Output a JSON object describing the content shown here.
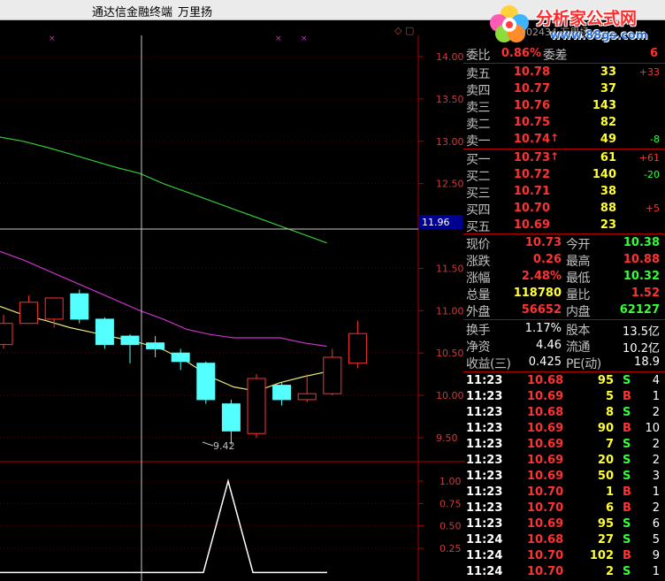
{
  "window": {
    "title": "通达信金融终端",
    "user": "万里扬"
  },
  "watermark": {
    "brand": "分析家公式网",
    "url": "www.88gs.com",
    "ghost_code": "002434 万里扬"
  },
  "colors": {
    "up": "#ff3232",
    "down": "#54ffff",
    "label": "#c0c0c0",
    "ma_green": "#34c834",
    "ma_magenta": "#c832c8",
    "ma_yellow": "#e6e678",
    "separator": "#b00000"
  },
  "chart": {
    "toolbar_icons": "◇ ▢",
    "price_ticks": [
      "14.00",
      "13.50",
      "13.00",
      "12.50",
      "11.50",
      "11.00",
      "10.50",
      "10.00",
      "9.50"
    ],
    "highlight_price": "11.96",
    "low_annotation": "9.42",
    "indicator_ticks": [
      "1.00",
      "0.75",
      "0.50",
      "0.25"
    ]
  },
  "chart_data": {
    "type": "candlestick",
    "ylim": [
      9.1,
      14.2
    ],
    "indicator_ylim": [
      0,
      1.15
    ],
    "candles": [
      {
        "open": 10.6,
        "close": 10.85,
        "high": 10.95,
        "low": 10.55
      },
      {
        "open": 10.85,
        "close": 11.1,
        "high": 11.18,
        "low": 10.85
      },
      {
        "open": 10.9,
        "close": 11.15,
        "high": 11.15,
        "low": 10.8
      },
      {
        "open": 11.2,
        "close": 10.9,
        "high": 11.25,
        "low": 10.85
      },
      {
        "open": 10.9,
        "close": 10.6,
        "high": 10.92,
        "low": 10.55
      },
      {
        "open": 10.7,
        "close": 10.6,
        "high": 10.72,
        "low": 10.38
      },
      {
        "open": 10.62,
        "close": 10.55,
        "high": 10.7,
        "low": 10.45
      },
      {
        "open": 10.5,
        "close": 10.4,
        "high": 10.55,
        "low": 10.3
      },
      {
        "open": 10.38,
        "close": 9.95,
        "high": 10.4,
        "low": 9.9
      },
      {
        "open": 9.9,
        "close": 9.58,
        "high": 9.95,
        "low": 9.42
      },
      {
        "open": 9.55,
        "close": 10.2,
        "high": 10.25,
        "low": 9.5
      },
      {
        "open": 10.12,
        "close": 9.95,
        "high": 10.15,
        "low": 9.88
      },
      {
        "open": 9.95,
        "close": 10.02,
        "high": 10.25,
        "low": 9.92
      },
      {
        "open": 10.02,
        "close": 10.45,
        "high": 10.55,
        "low": 10.0
      },
      {
        "open": 10.38,
        "close": 10.73,
        "high": 10.88,
        "low": 10.32
      }
    ],
    "ma_green": [
      13.05,
      13.0,
      12.93,
      12.85,
      12.77,
      12.69,
      12.62,
      12.5,
      12.4,
      12.3,
      12.2,
      12.1,
      12.0,
      11.9,
      11.8
    ],
    "ma_magenta": [
      11.7,
      11.6,
      11.48,
      11.36,
      11.24,
      11.12,
      11.0,
      10.9,
      10.78,
      10.72,
      10.68,
      10.68,
      10.68,
      10.62,
      10.58
    ],
    "ma_yellow": [
      11.05,
      10.95,
      10.88,
      10.8,
      10.74,
      10.68,
      10.62,
      10.54,
      10.4,
      10.22,
      10.1,
      10.05,
      10.15,
      10.22,
      10.28
    ],
    "signal": [
      0,
      0,
      0,
      0,
      0,
      0,
      0,
      0,
      0,
      0,
      0,
      0,
      1,
      0,
      0,
      0,
      0,
      0,
      0,
      0
    ]
  },
  "quote": {
    "weibi": {
      "label": "委比",
      "value": "0.86%",
      "label2": "委差",
      "value2": "6"
    },
    "asks": [
      {
        "label": "卖五",
        "price": "10.78",
        "vol": "33",
        "chg": "+33",
        "arrow": ""
      },
      {
        "label": "卖四",
        "price": "10.77",
        "vol": "37",
        "chg": "",
        "arrow": ""
      },
      {
        "label": "卖三",
        "price": "10.76",
        "vol": "143",
        "chg": "",
        "arrow": ""
      },
      {
        "label": "卖二",
        "price": "10.75",
        "vol": "82",
        "chg": "",
        "arrow": ""
      },
      {
        "label": "卖一",
        "price": "10.74",
        "vol": "49",
        "chg": "-8",
        "arrow": "↑"
      }
    ],
    "bids": [
      {
        "label": "买一",
        "price": "10.73",
        "vol": "61",
        "chg": "+61",
        "arrow": "↑"
      },
      {
        "label": "买二",
        "price": "10.72",
        "vol": "140",
        "chg": "-20",
        "arrow": ""
      },
      {
        "label": "买三",
        "price": "10.71",
        "vol": "38",
        "chg": "",
        "arrow": ""
      },
      {
        "label": "买四",
        "price": "10.70",
        "vol": "88",
        "chg": "+5",
        "arrow": ""
      },
      {
        "label": "买五",
        "price": "10.69",
        "vol": "23",
        "chg": "",
        "arrow": ""
      }
    ],
    "stats": [
      {
        "l1": "现价",
        "v1": "10.73",
        "c1": "red",
        "l2": "今开",
        "v2": "10.38",
        "c2": "green"
      },
      {
        "l1": "涨跌",
        "v1": "0.26",
        "c1": "red",
        "l2": "最高",
        "v2": "10.88",
        "c2": "red"
      },
      {
        "l1": "涨幅",
        "v1": "2.48%",
        "c1": "red",
        "l2": "最低",
        "v2": "10.32",
        "c2": "green"
      },
      {
        "l1": "总量",
        "v1": "118780",
        "c1": "yellow",
        "l2": "量比",
        "v2": "1.52",
        "c2": "red"
      },
      {
        "l1": "外盘",
        "v1": "56652",
        "c1": "red",
        "l2": "内盘",
        "v2": "62127",
        "c2": "green"
      }
    ],
    "stats2": [
      {
        "l1": "换手",
        "v1": "1.17%",
        "c1": "white",
        "l2": "股本",
        "v2": "13.5亿",
        "c2": "white"
      },
      {
        "l1": "净资",
        "v1": "4.46",
        "c1": "white",
        "l2": "流通",
        "v2": "10.2亿",
        "c2": "white"
      },
      {
        "l1": "收益(三)",
        "v1": "0.425",
        "c1": "white",
        "l2": "PE(动)",
        "v2": "18.9",
        "c2": "white"
      }
    ],
    "ticks": [
      {
        "time": "11:23",
        "price": "10.68",
        "vol": "95",
        "side": "S",
        "n": "4"
      },
      {
        "time": "11:23",
        "price": "10.69",
        "vol": "5",
        "side": "B",
        "n": "1"
      },
      {
        "time": "11:23",
        "price": "10.68",
        "vol": "8",
        "side": "S",
        "n": "2"
      },
      {
        "time": "11:23",
        "price": "10.69",
        "vol": "90",
        "side": "B",
        "n": "10"
      },
      {
        "time": "11:23",
        "price": "10.69",
        "vol": "7",
        "side": "S",
        "n": "2"
      },
      {
        "time": "11:23",
        "price": "10.69",
        "vol": "20",
        "side": "S",
        "n": "2"
      },
      {
        "time": "11:23",
        "price": "10.69",
        "vol": "50",
        "side": "S",
        "n": "3"
      },
      {
        "time": "11:23",
        "price": "10.70",
        "vol": "1",
        "side": "B",
        "n": "1"
      },
      {
        "time": "11:23",
        "price": "10.70",
        "vol": "6",
        "side": "B",
        "n": "2"
      },
      {
        "time": "11:23",
        "price": "10.69",
        "vol": "95",
        "side": "S",
        "n": "6"
      },
      {
        "time": "11:24",
        "price": "10.68",
        "vol": "27",
        "side": "S",
        "n": "5"
      },
      {
        "time": "11:24",
        "price": "10.70",
        "vol": "102",
        "side": "B",
        "n": "9"
      },
      {
        "time": "11:24",
        "price": "10.70",
        "vol": "2",
        "side": "S",
        "n": "1"
      }
    ]
  }
}
